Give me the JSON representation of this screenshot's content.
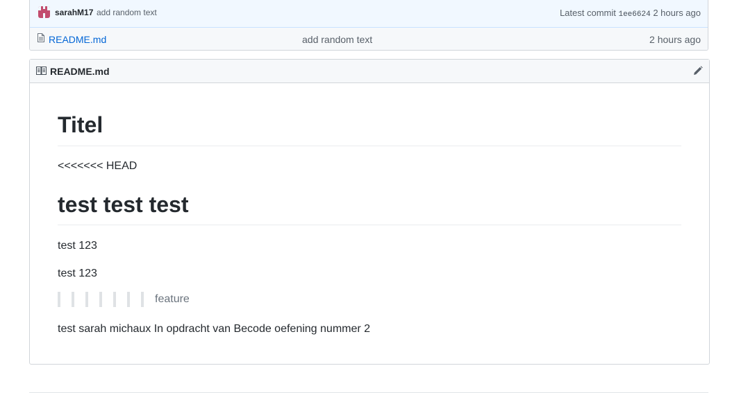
{
  "commit": {
    "author": "sarahM17",
    "message": "add random text",
    "latest_label": "Latest commit",
    "sha": "1ee6624",
    "age": "2 hours ago"
  },
  "files": [
    {
      "name": "README.md",
      "message": "add random text",
      "age": "2 hours ago",
      "icon": "file-icon"
    }
  ],
  "readme": {
    "title": "README.md",
    "icon": "book-icon",
    "edit_icon": "pencil-icon",
    "content": {
      "heading1": "Titel",
      "conflict_marker": "<<<<<<< HEAD",
      "heading2": "test test test",
      "line1": "test 123",
      "line2": "test 123",
      "quote": "feature",
      "footer_text": "test sarah michaux In opdracht van Becode oefening nummer 2"
    }
  },
  "colors": {
    "link": "#0366d6",
    "commit_bar_bg": "#f1f8ff",
    "avatar": "#c24c6e",
    "muted": "#586069"
  }
}
